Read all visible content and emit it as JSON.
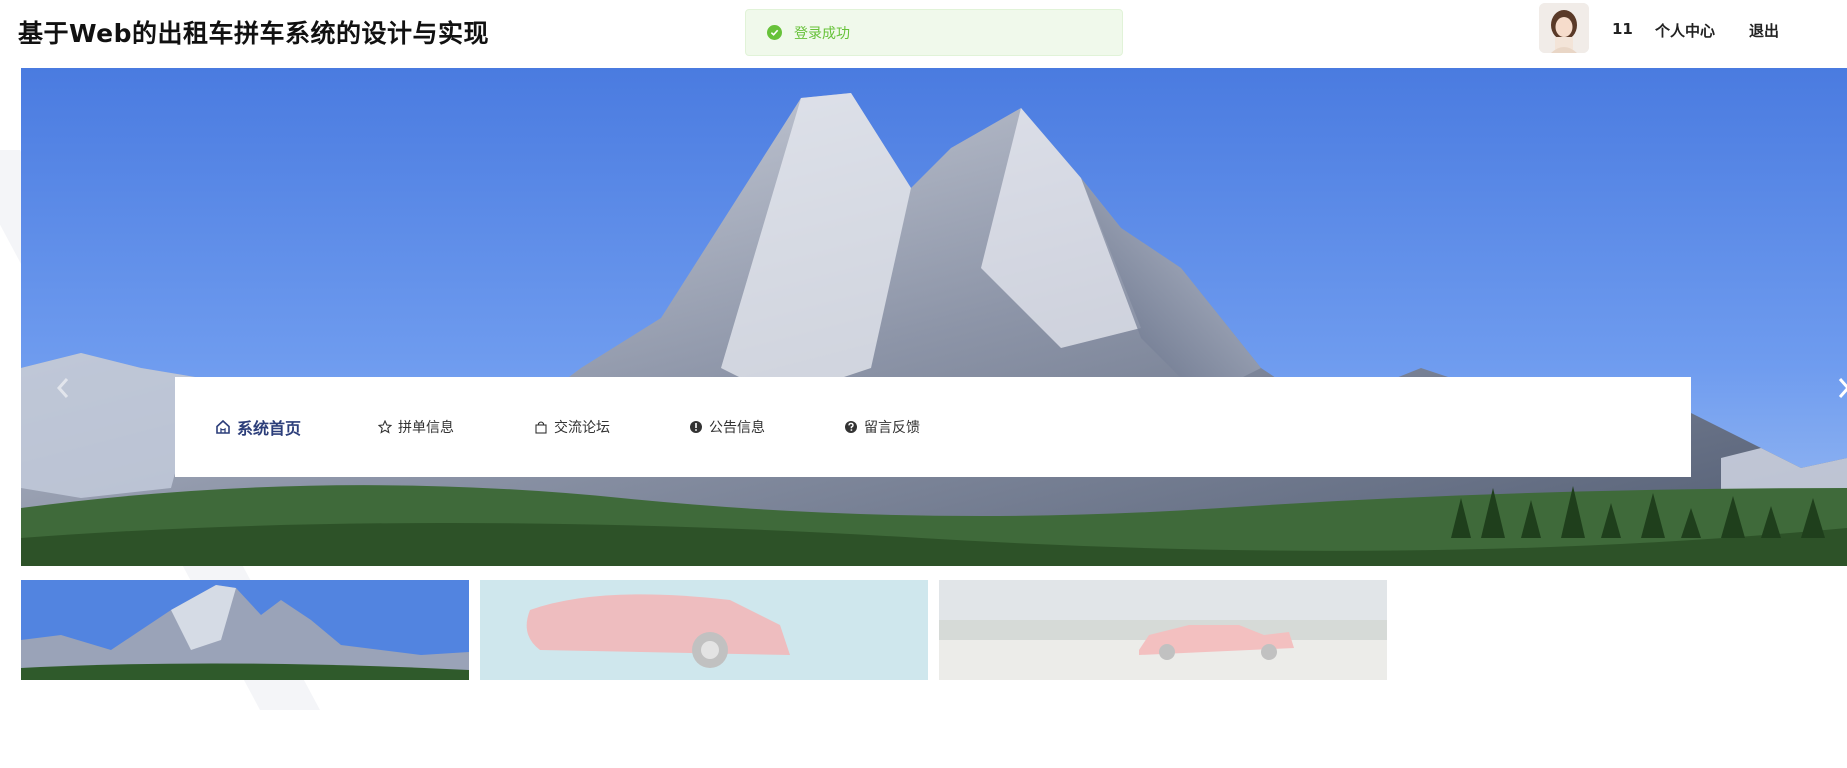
{
  "header": {
    "site_title": "基于Web的出租车拼车系统的设计与实现",
    "username": "11",
    "profile_label": "个人中心",
    "logout_label": "退出"
  },
  "toast": {
    "message": "登录成功",
    "color": "#67c23a"
  },
  "nav": {
    "items": [
      {
        "label": "系统首页",
        "icon": "home-icon",
        "active": true
      },
      {
        "label": "拼单信息",
        "icon": "star-icon",
        "active": false
      },
      {
        "label": "交流论坛",
        "icon": "bag-icon",
        "active": false
      },
      {
        "label": "公告信息",
        "icon": "alert-circle-icon",
        "active": false
      },
      {
        "label": "留言反馈",
        "icon": "question-circle-icon",
        "active": false
      }
    ]
  },
  "carousel": {
    "active_index": 0,
    "slides": [
      "mountain",
      "red-sports-car",
      "red-ferrari"
    ],
    "prev_icon": "chevron-left-icon",
    "next_icon": "chevron-right-icon"
  },
  "colors": {
    "accent": "#2c3e7a",
    "success": "#67c23a",
    "sky": "#4f7fdc"
  }
}
